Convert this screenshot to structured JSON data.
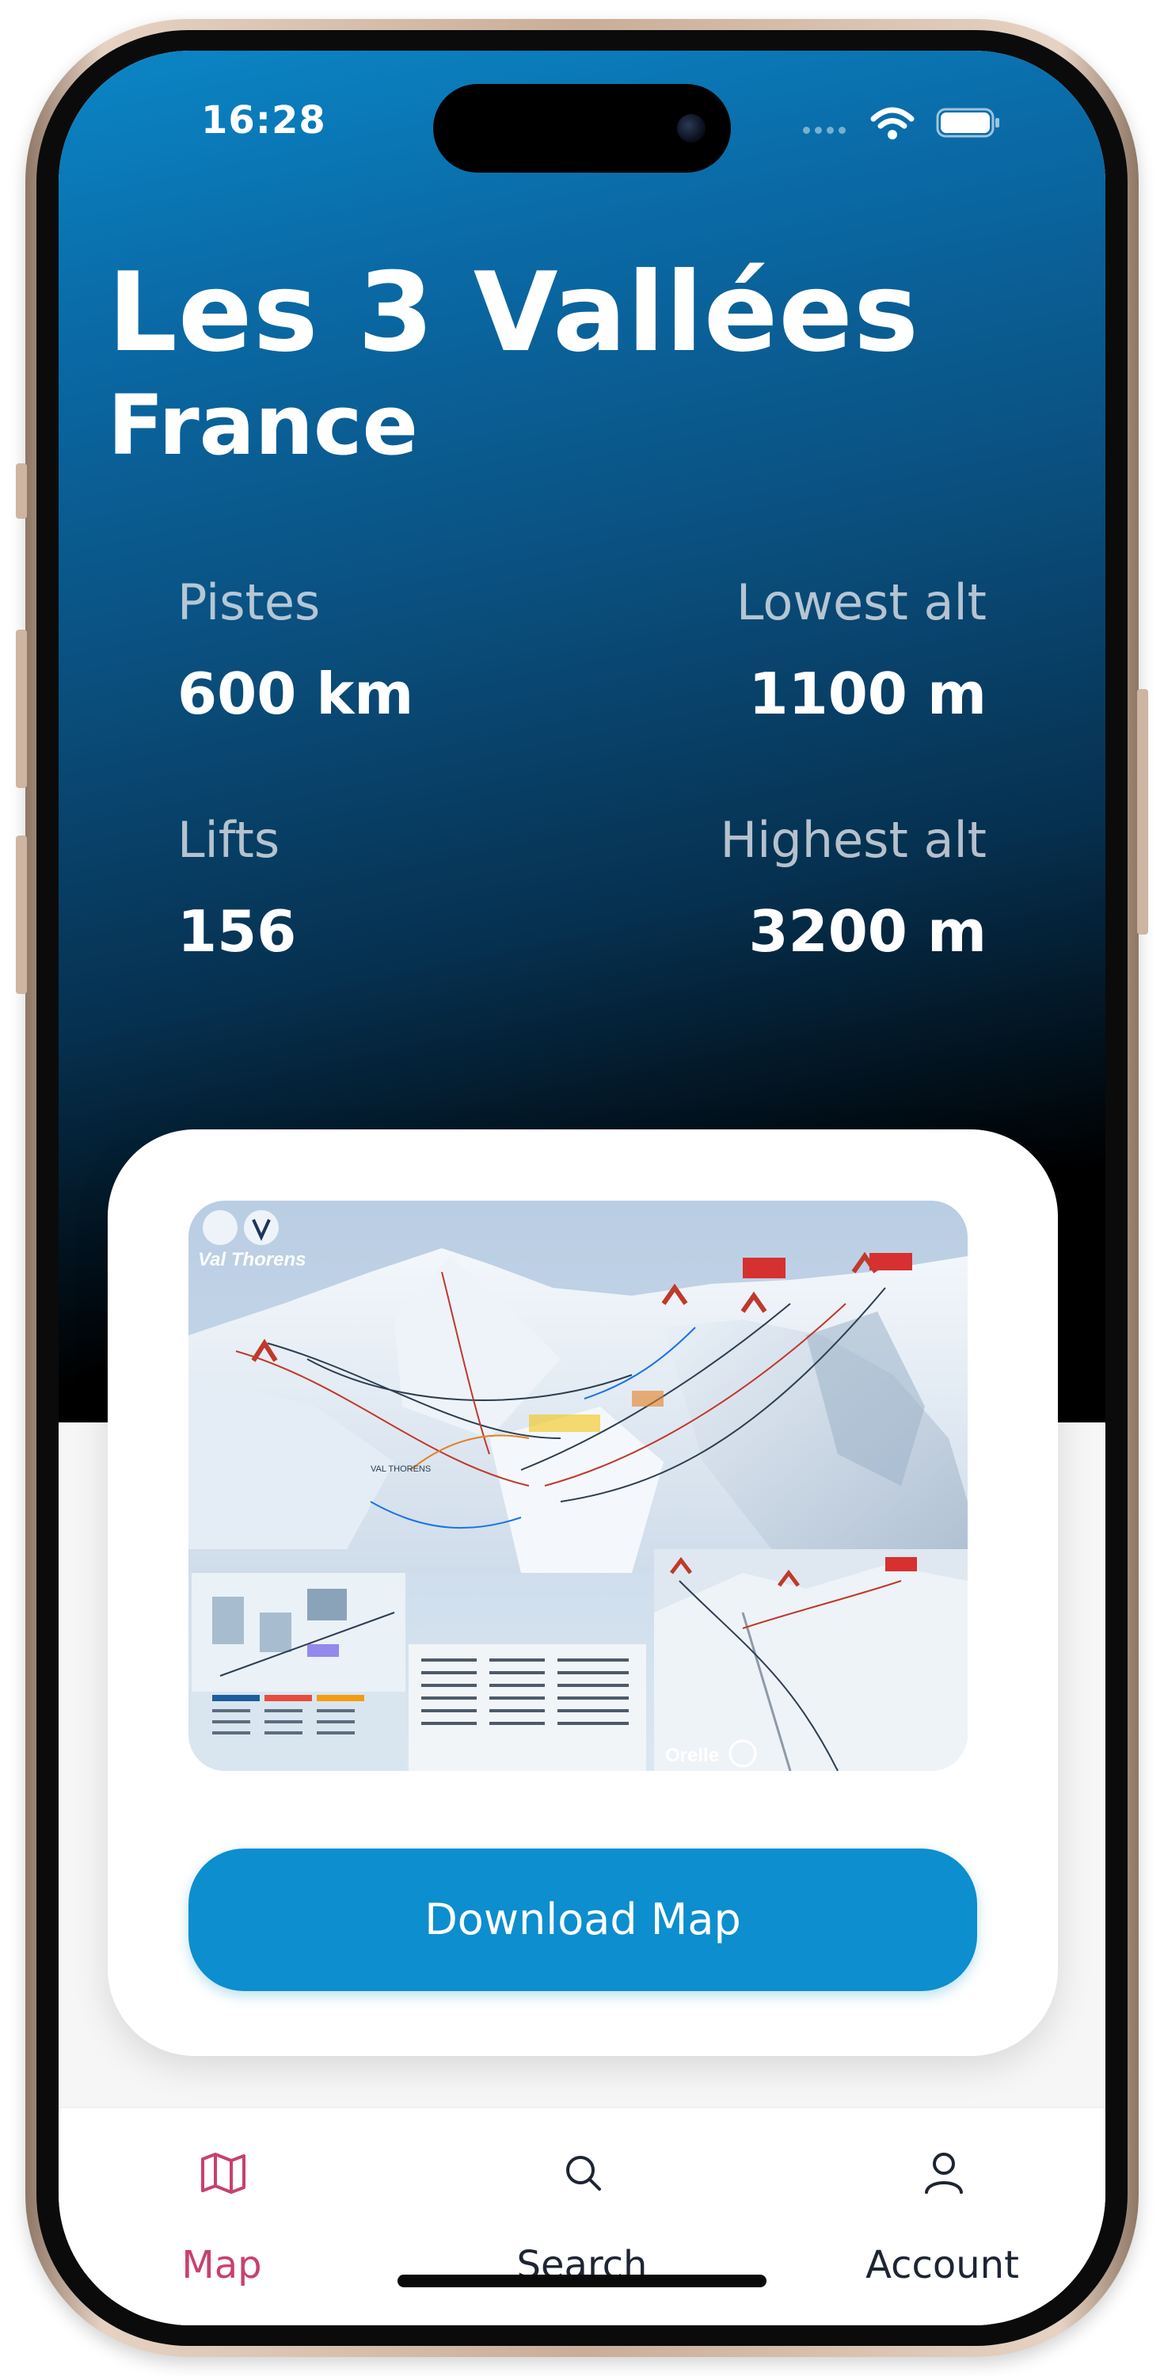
{
  "status": {
    "time": "16:28"
  },
  "resort": {
    "name": "Les 3 Vallées",
    "country": "France"
  },
  "stats": {
    "pistes": {
      "label": "Pistes",
      "value": "600 km"
    },
    "lowest_alt": {
      "label": "Lowest alt",
      "value": "1100 m"
    },
    "lifts": {
      "label": "Lifts",
      "value": "156"
    },
    "highest_alt": {
      "label": "Highest alt",
      "value": "3200 m"
    }
  },
  "map_card": {
    "map_labels": {
      "brand_top": "Val Thorens",
      "brand_bottom": "Orelle",
      "village": "VAL THORENS"
    },
    "download_label": "Download Map"
  },
  "tabbar": {
    "items": [
      {
        "label": "Map",
        "icon": "map-icon",
        "active": true
      },
      {
        "label": "Search",
        "icon": "search-icon",
        "active": false
      },
      {
        "label": "Account",
        "icon": "account-icon",
        "active": false
      }
    ],
    "active_color": "#c8416d",
    "inactive_color": "#1d2533"
  },
  "colors": {
    "accent": "#0c8ecf",
    "hero_top": "#0b86c6",
    "hero_bottom": "#000000"
  }
}
